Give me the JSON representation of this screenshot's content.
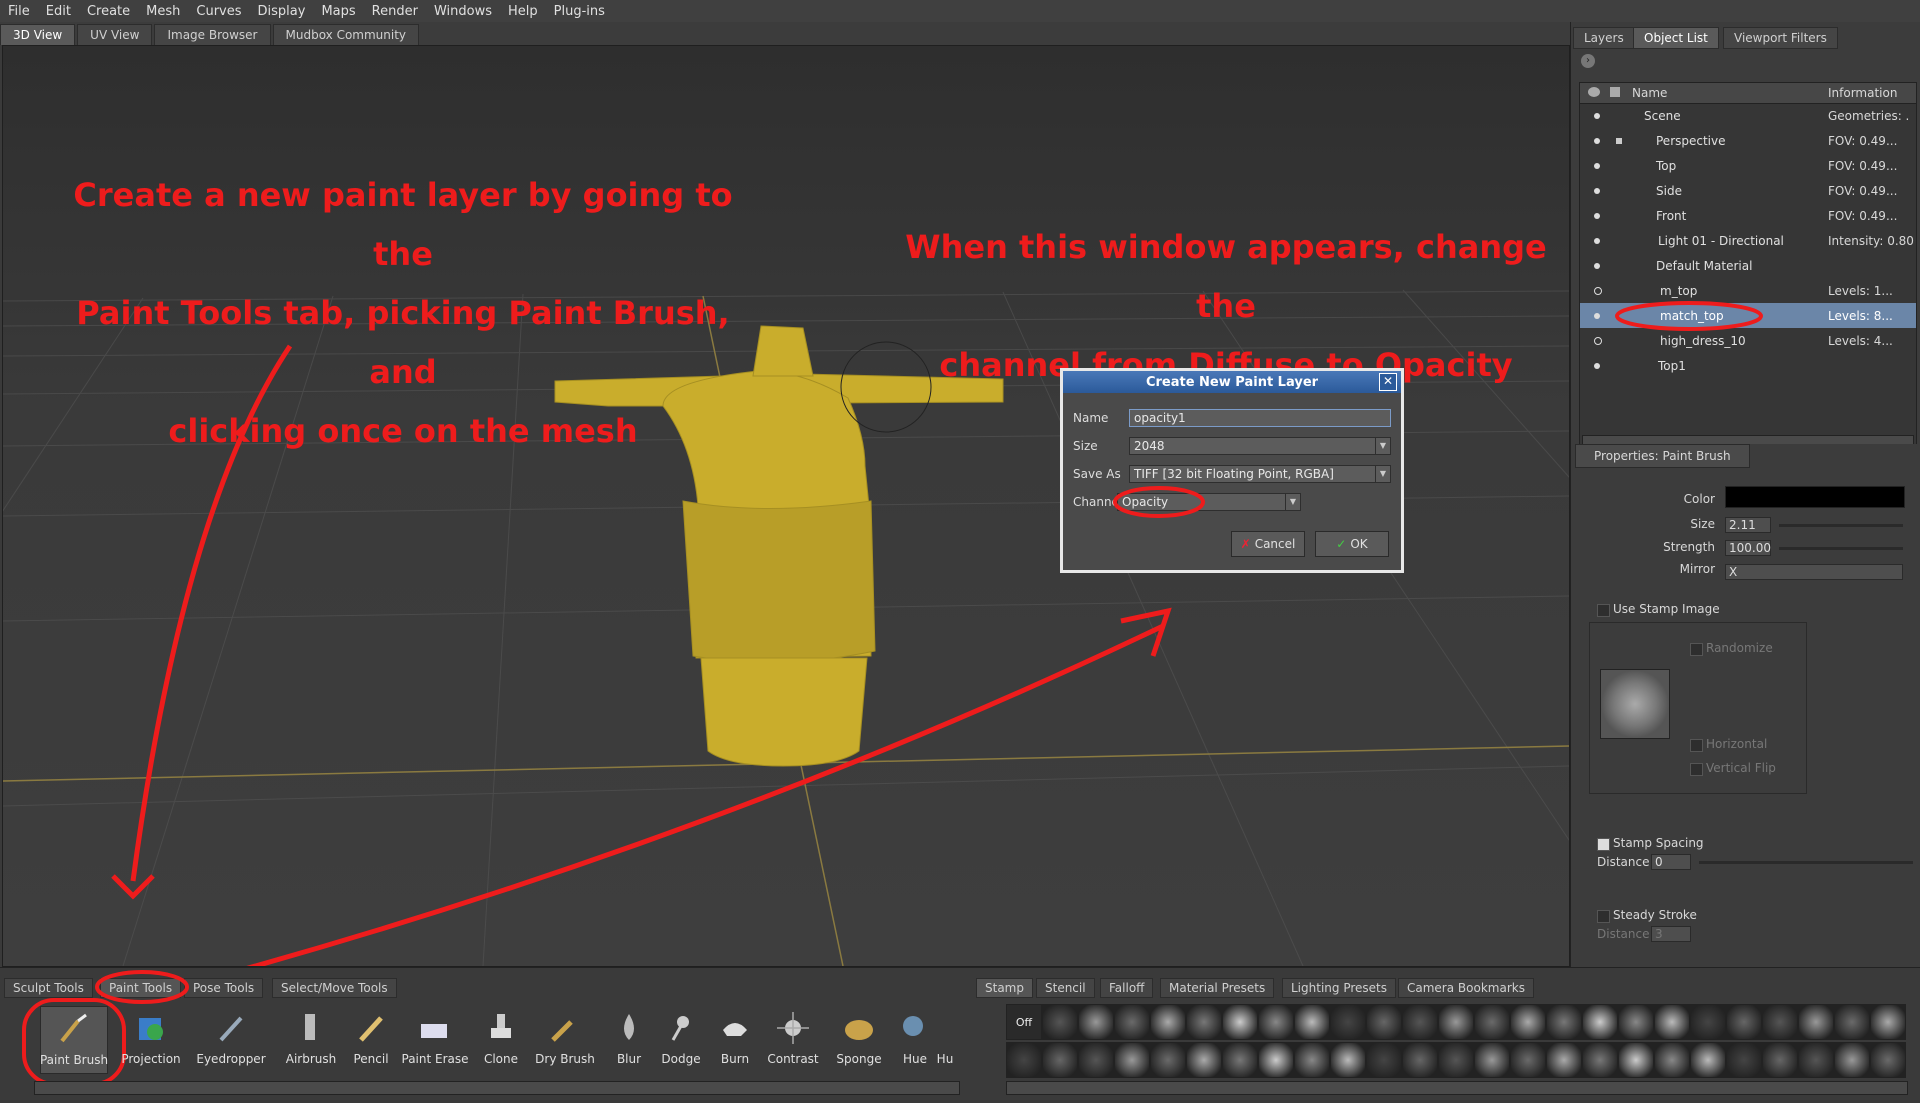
{
  "menu": [
    "File",
    "Edit",
    "Create",
    "Mesh",
    "Curves",
    "Display",
    "Maps",
    "Render",
    "Windows",
    "Help",
    "Plug-ins"
  ],
  "view_tabs": [
    "3D View",
    "UV View",
    "Image Browser",
    "Mudbox Community"
  ],
  "annotations": {
    "left": [
      "Create a new paint layer by going to the",
      "Paint Tools tab, picking Paint Brush, and",
      "clicking once on the mesh"
    ],
    "right": [
      "When this window appears, change the",
      "channel from Diffuse to Opacity"
    ],
    "color": "#ee1c1c"
  },
  "dialog": {
    "title": "Create New Paint Layer",
    "name_label": "Name",
    "name_value": "opacity1",
    "size_label": "Size",
    "size_value": "2048",
    "saveas_label": "Save As",
    "saveas_value": "TIFF [32 bit Floating Point, RGBA]",
    "channel_label": "Channel",
    "channel_value": "Opacity",
    "cancel_label": "Cancel",
    "ok_label": "OK"
  },
  "right_tabs": [
    "Layers",
    "Object List",
    "Viewport Filters"
  ],
  "object_list": {
    "col_name": "Name",
    "col_info": "Information",
    "rows": [
      {
        "name": "Scene",
        "info": "Geometries: ."
      },
      {
        "name": "Perspective",
        "info": "FOV: 0.49..."
      },
      {
        "name": "Top",
        "info": "FOV: 0.49..."
      },
      {
        "name": "Side",
        "info": "FOV: 0.49..."
      },
      {
        "name": "Front",
        "info": "FOV: 0.49..."
      },
      {
        "name": "Light 01 - Directional",
        "info": "Intensity: 0.80"
      },
      {
        "name": "Default Material",
        "info": ""
      },
      {
        "name": "m_top",
        "info": "Levels: 1..."
      },
      {
        "name": "match_top",
        "info": "Levels: 8..."
      },
      {
        "name": "high_dress_10",
        "info": "Levels: 4..."
      },
      {
        "name": "Top1",
        "info": ""
      }
    ]
  },
  "properties": {
    "tab": "Properties: Paint Brush",
    "color_label": "Color",
    "color_value": "#000000",
    "size_label": "Size",
    "size_value": "2.11",
    "strength_label": "Strength",
    "strength_value": "100.00",
    "mirror_label": "Mirror",
    "mirror_value": "X",
    "use_stamp_label": "Use Stamp Image",
    "randomize_label": "Randomize",
    "horizontal_label": "Horizontal",
    "vertical_label": "Vertical Flip",
    "stamp_spacing_label": "Stamp Spacing",
    "distance_label": "Distance",
    "distance_value": "0",
    "steady_label": "Steady Stroke",
    "steady_distance_label": "Distance",
    "steady_distance_value": "3"
  },
  "tool_tabs": [
    "Sculpt Tools",
    "Paint Tools",
    "Pose Tools",
    "Select/Move Tools"
  ],
  "tools": [
    "Paint Brush",
    "Projection",
    "Eyedropper",
    "Airbrush",
    "Pencil",
    "Paint Erase",
    "Clone",
    "Dry Brush",
    "Blur",
    "Dodge",
    "Burn",
    "Contrast",
    "Sponge",
    "Hue",
    "Hu"
  ],
  "tray_tabs": [
    "Stamp",
    "Stencil",
    "Falloff",
    "Material Presets",
    "Lighting Presets",
    "Camera Bookmarks"
  ],
  "stamp_off": "Off"
}
